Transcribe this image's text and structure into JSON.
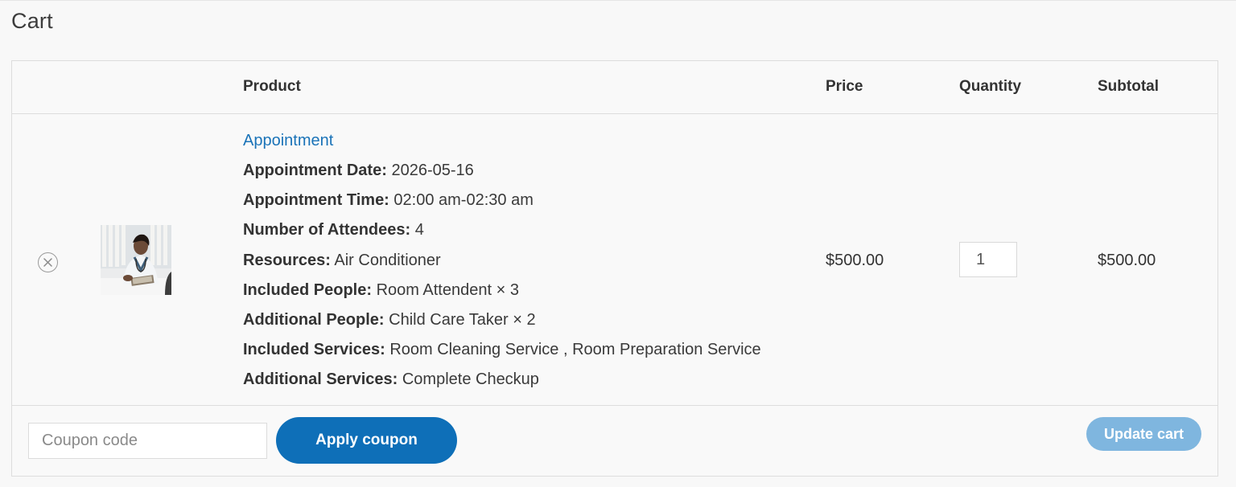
{
  "page": {
    "title": "Cart"
  },
  "table": {
    "headers": {
      "product": "Product",
      "price": "Price",
      "quantity": "Quantity",
      "subtotal": "Subtotal"
    },
    "item": {
      "remove_icon": "close-circle-icon",
      "thumbnail": "doctor-photo",
      "product_name": "Appointment",
      "meta": [
        {
          "label": "Appointment Date:",
          "value": "2026-05-16"
        },
        {
          "label": "Appointment Time:",
          "value": "02:00 am-02:30 am"
        },
        {
          "label": "Number of Attendees:",
          "value": "4"
        },
        {
          "label": "Resources:",
          "value": "Air Conditioner"
        },
        {
          "label": "Included People:",
          "value": "Room Attendent × 3"
        },
        {
          "label": "Additional People:",
          "value": "Child Care Taker × 2"
        },
        {
          "label": "Included Services:",
          "value": "Room Cleaning Service , Room Preparation Service"
        },
        {
          "label": "Additional Services:",
          "value": "Complete Checkup"
        }
      ],
      "price": "$500.00",
      "quantity": "1",
      "subtotal": "$500.00"
    }
  },
  "actions": {
    "coupon_placeholder": "Coupon code",
    "apply_label": "Apply coupon",
    "update_label": "Update cart"
  },
  "colors": {
    "link": "#1a73b8",
    "primary_button": "#0e6fb8",
    "disabled_button": "#7fb6df"
  }
}
